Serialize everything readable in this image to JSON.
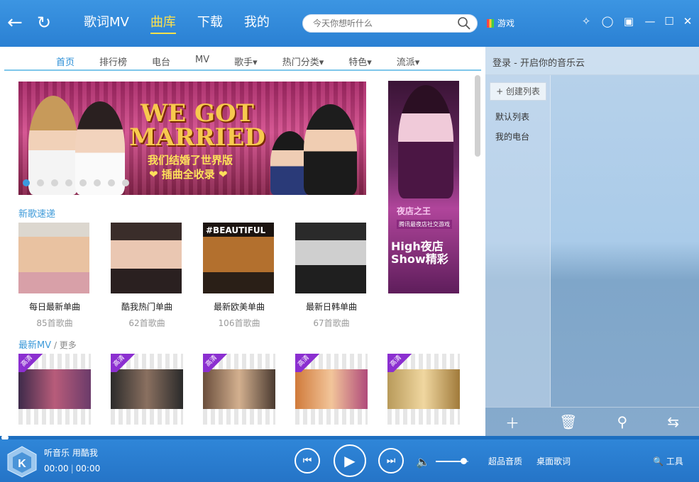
{
  "window": {
    "nav_tabs": [
      {
        "label": "歌词MV"
      },
      {
        "label": "曲库"
      },
      {
        "label": "下载"
      },
      {
        "label": "我的"
      }
    ],
    "active_tab": "曲库",
    "search_placeholder": "今天你想听什么",
    "game_label": "游戏"
  },
  "subnav": {
    "items": [
      "首页",
      "排行榜",
      "电台",
      "MV",
      "歌手▾",
      "热门分类▾",
      "特色▾",
      "流派▾"
    ]
  },
  "banner": {
    "title": "WE GOT MARRIED",
    "line1": "我们结婚了世界版",
    "line2": "❤ 插曲全收录 ❤",
    "dots_total": 8,
    "dots_active": 1
  },
  "side_ad": {
    "logo": "夜店之王",
    "sub": "腾讯最夜店社交游戏",
    "text": "High夜店 Show精彩"
  },
  "new_songs": {
    "title": "新歌速递",
    "albums": [
      {
        "name": "每日最新单曲",
        "count": "85首歌曲"
      },
      {
        "name": "酷我热门单曲",
        "count": "62首歌曲"
      },
      {
        "name": "最新欧美单曲",
        "count": "106首歌曲"
      },
      {
        "name": "最新日韩单曲",
        "count": "67首歌曲"
      }
    ],
    "cover3_text": "#BEAUTIFUL"
  },
  "mv": {
    "title": "最新MV",
    "more": " / 更多",
    "badge": "高清",
    "items": [
      "",
      "",
      "",
      "",
      ""
    ]
  },
  "sidebar": {
    "login_text": "登录 - 开启你的音乐云",
    "create_list": "+ 创建列表",
    "lists": [
      "默认列表",
      "我的电台"
    ]
  },
  "player": {
    "slogan": "听音乐 用酷我",
    "time_current": "00:00",
    "time_total": "00:00",
    "volume": 0.85,
    "quality": "超品音质",
    "desktop_lyrics": "桌面歌词",
    "tools": "工具"
  },
  "colors": {
    "accent": "#2a80d3",
    "active_tab": "#ffe14c",
    "hd_badge": "#8b2fd0"
  }
}
